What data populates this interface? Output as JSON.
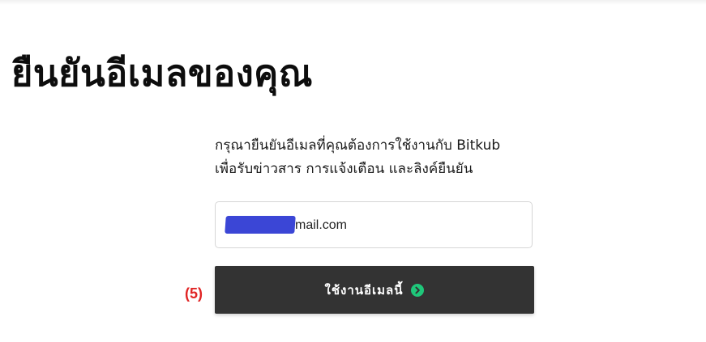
{
  "page": {
    "title": "ยืนยันอีเมลของคุณ"
  },
  "instructions": {
    "line1": "กรุณายืนยันอีเมลที่คุณต้องการใช้งานกับ Bitkub",
    "line2": "เพื่อรับข่าวสาร การแจ้งเตือน และลิงค์ยืนยัน"
  },
  "email_field": {
    "visible_value": "mail.com",
    "redacted": true,
    "redaction_color": "#3b46d6"
  },
  "step_marker": {
    "label": "(5)",
    "color": "#e02424"
  },
  "submit_button": {
    "label": "ใช้งานอีเมลนี้",
    "background": "#333333",
    "icon": "arrow-right-circle-icon",
    "icon_color": "#1fc77a"
  }
}
